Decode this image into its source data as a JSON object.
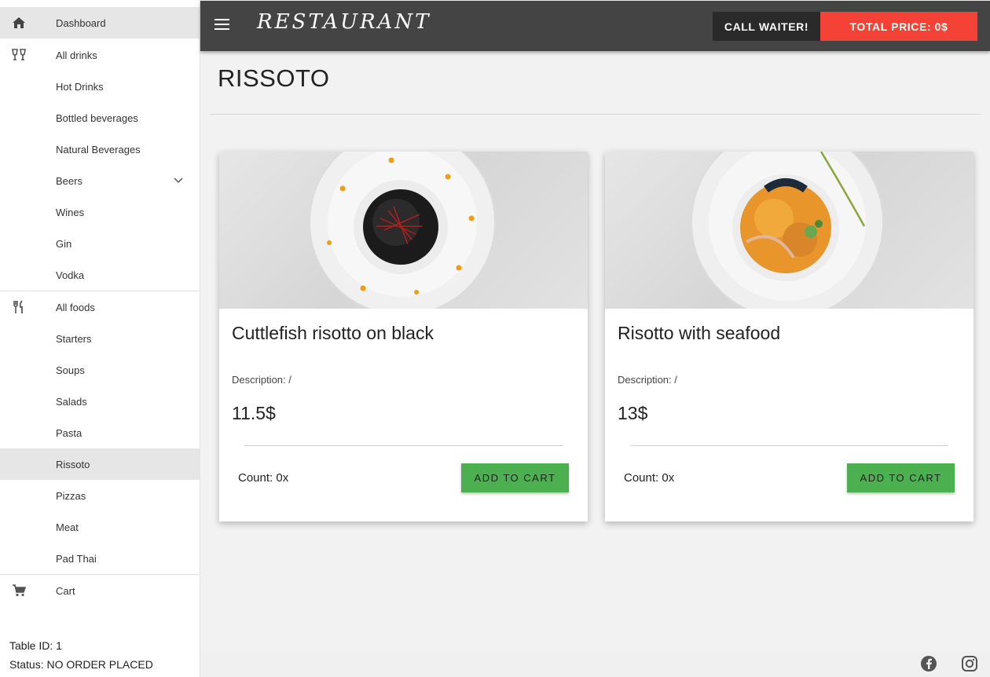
{
  "sidebar": {
    "items": [
      {
        "label": "Dashboard",
        "icon": "home-icon"
      },
      {
        "label": "All drinks",
        "icon": "glasses-icon"
      },
      {
        "label": "Hot Drinks"
      },
      {
        "label": "Bottled beverages"
      },
      {
        "label": "Natural Beverages"
      },
      {
        "label": "Beers",
        "icon": "chevron-down-icon"
      },
      {
        "label": "Wines"
      },
      {
        "label": "Gin"
      },
      {
        "label": "Vodka"
      },
      {
        "label": "All foods",
        "icon": "utensils-icon"
      },
      {
        "label": "Starters"
      },
      {
        "label": "Soups"
      },
      {
        "label": "Salads"
      },
      {
        "label": "Pasta"
      },
      {
        "label": "Rissoto",
        "active": true
      },
      {
        "label": "Pizzas"
      },
      {
        "label": "Meat"
      },
      {
        "label": "Pad Thai"
      },
      {
        "label": "Cart",
        "icon": "cart-icon"
      }
    ],
    "table_id": "Table ID: 1",
    "status": "Status: NO ORDER PLACED"
  },
  "header": {
    "brand": "RESTAURANT",
    "call_waiter": "CALL WAITER!",
    "total_price": "TOTAL PRICE: 0$"
  },
  "main": {
    "title": "RISSOTO",
    "cards": [
      {
        "name": "Cuttlefish risotto on black",
        "description": "Description: /",
        "price": "11.5$",
        "count": "Count: 0x",
        "button": "ADD TO CART"
      },
      {
        "name": "Risotto with seafood",
        "description": "Description: /",
        "price": "13$",
        "count": "Count: 0x",
        "button": "ADD TO CART"
      }
    ]
  },
  "footer": {
    "icons": [
      "facebook-icon",
      "instagram-icon"
    ]
  },
  "colors": {
    "header_bg": "#444444",
    "waiter_bg": "#2a2a2a",
    "total_bg": "#f44336",
    "add_to_cart_bg": "#4caf50",
    "active_nav_bg": "#e6e6e6"
  }
}
